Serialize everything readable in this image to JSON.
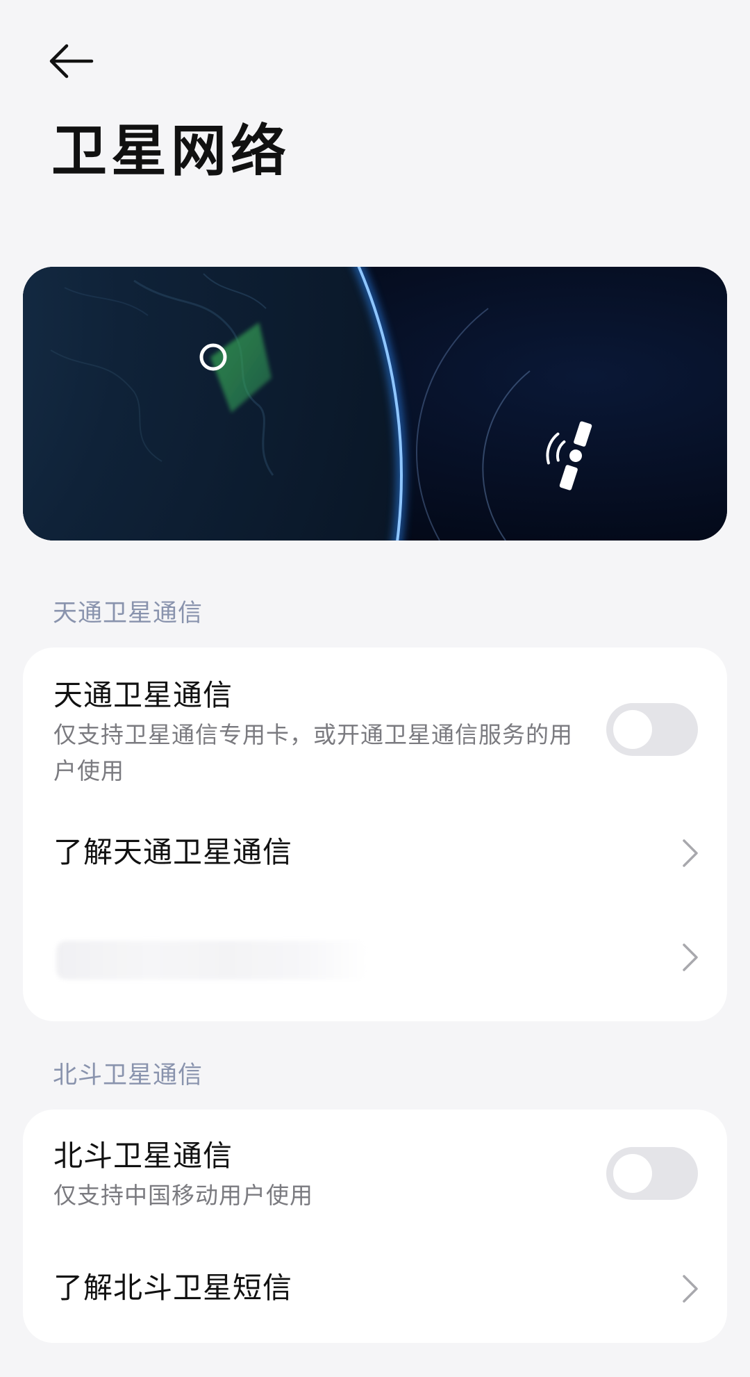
{
  "header": {
    "back_icon": "arrow-left-icon",
    "title": "卫星网络"
  },
  "hero": {
    "illustration": "earth-and-satellite",
    "satellite_icon": "satellite-signal-icon",
    "colors": {
      "space": "#040b1c",
      "atmosphere_glow": "#2f8cff",
      "coverage_area": "#3fbf67"
    }
  },
  "tiantong": {
    "section_label": "天通卫星通信",
    "toggle_row": {
      "title": "天通卫星通信",
      "description": "仅支持卫星通信专用卡，或开通卫星通信服务的用户使用",
      "toggle_on": false
    },
    "learn_row": {
      "title": "了解天通卫星通信"
    },
    "obscured_row": {
      "chevron_icon": "chevron-right-icon"
    }
  },
  "beidou": {
    "section_label": "北斗卫星通信",
    "toggle_row": {
      "title": "北斗卫星通信",
      "description": "仅支持中国移动用户使用",
      "toggle_on": false
    },
    "learn_row": {
      "title": "了解北斗卫星短信"
    }
  },
  "colors": {
    "background": "#f5f5f7",
    "card": "#ffffff",
    "section_label": "#8993ad",
    "secondary_text": "#7a7a7f",
    "toggle_off": "#e4e4e8",
    "chevron": "#a8a8ad"
  }
}
